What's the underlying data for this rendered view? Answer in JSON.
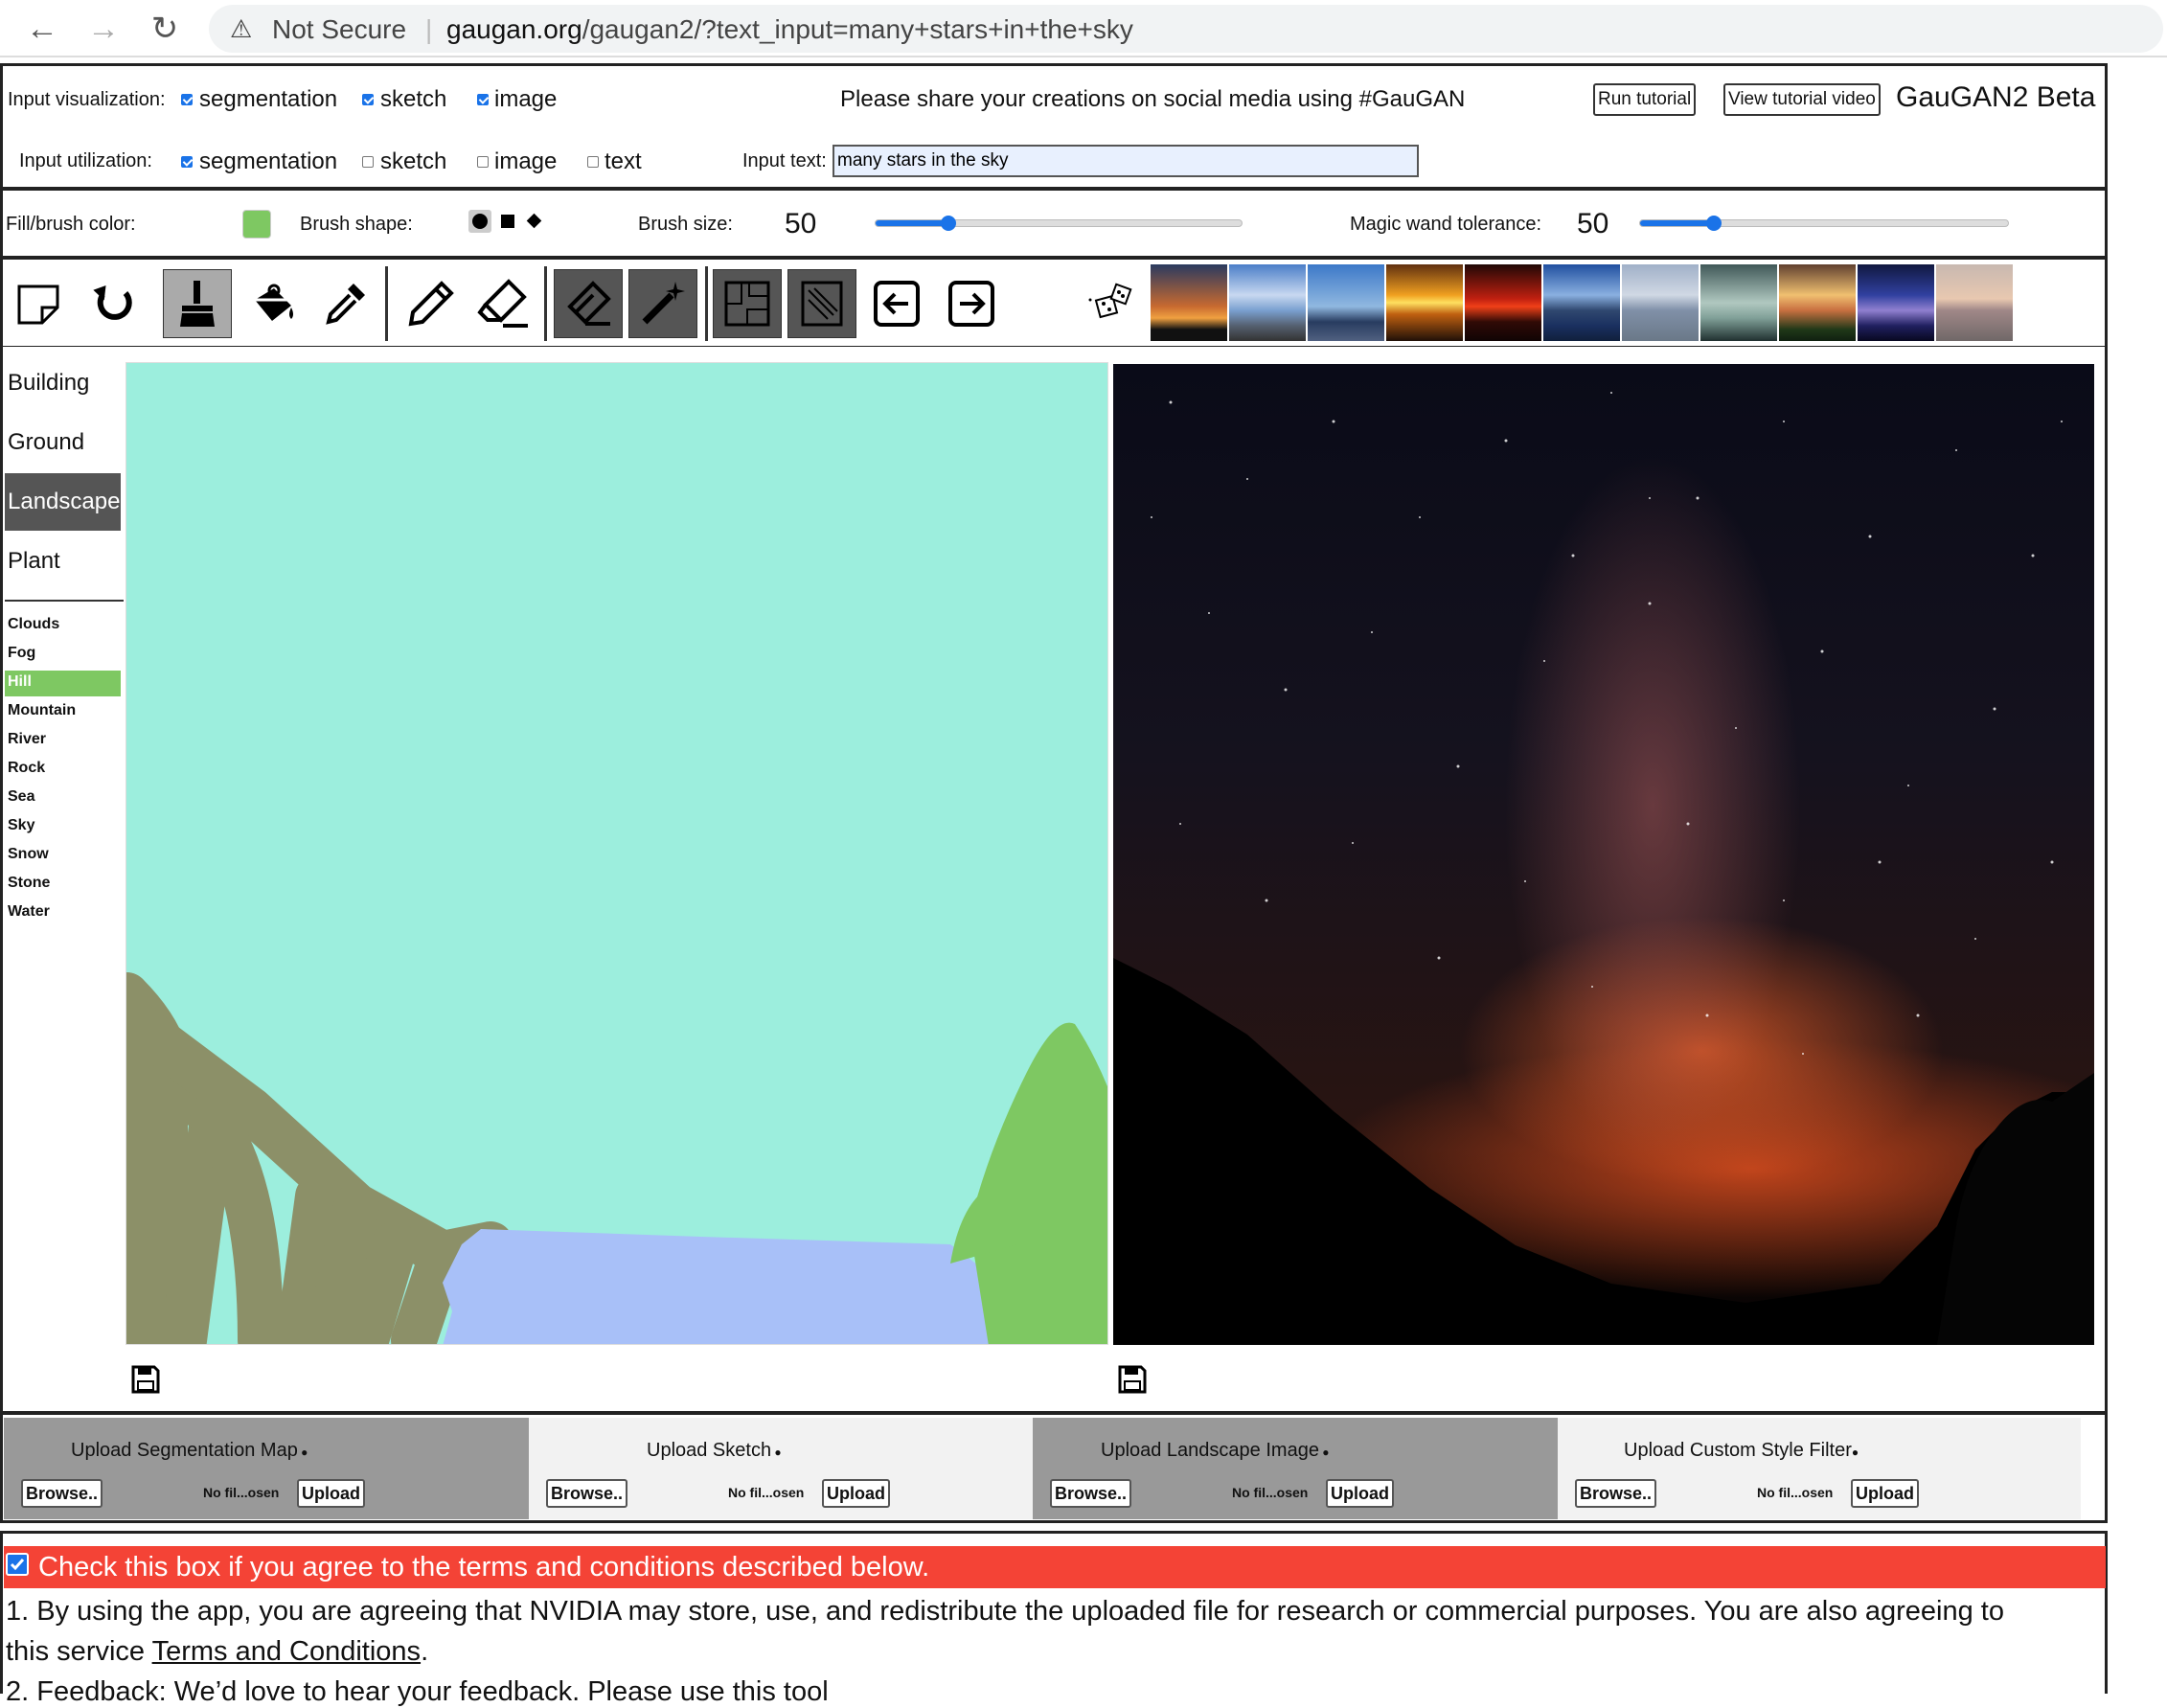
{
  "browser": {
    "security_label": "Not Secure",
    "url_host": "gaugan.org",
    "url_path": "/gaugan2/?text_input=many+stars+in+the+sky"
  },
  "header": {
    "input_visualization_label": "Input visualization:",
    "vis_segmentation": "segmentation",
    "vis_sketch": "sketch",
    "vis_image": "image",
    "share_text": "Please share your creations on social media using #GauGAN",
    "run_tutorial": "Run tutorial",
    "view_tutorial_video": "View tutorial video",
    "app_title": "GauGAN2 Beta",
    "input_utilization_label": "Input utilization:",
    "util_segmentation": "segmentation",
    "util_sketch": "sketch",
    "util_image": "image",
    "util_text": "text",
    "input_text_label": "Input text:",
    "input_text_value": "many stars in the sky"
  },
  "brush": {
    "fill_color_label": "Fill/brush color:",
    "fill_color": "#7ec862",
    "brush_shape_label": "Brush shape:",
    "brush_size_label": "Brush size:",
    "brush_size_value": "50",
    "brush_size_fraction": 0.2,
    "magic_wand_label": "Magic wand tolerance:",
    "magic_wand_value": "50",
    "magic_wand_fraction": 0.2
  },
  "tools": [
    "new-canvas-icon",
    "undo-icon",
    "brush-icon",
    "paint-bucket-icon",
    "eyedropper-icon",
    "pencil-icon",
    "sketch-eraser-icon",
    "eraser-icon",
    "magic-wand-icon",
    "segment-to-sketch-icon",
    "sketch-to-segment-icon",
    "arrow-left-icon",
    "arrow-right-icon",
    "dice-icon"
  ],
  "categories": {
    "main": [
      "Building",
      "Ground",
      "Landscape",
      "Plant"
    ],
    "selected_main": "Landscape",
    "sub": [
      "Clouds",
      "Fog",
      "Hill",
      "Mountain",
      "River",
      "Rock",
      "Sea",
      "Sky",
      "Snow",
      "Stone",
      "Water"
    ],
    "selected_sub": "Hill",
    "selected_sub_color": "#7ec862"
  },
  "colors": {
    "sky_label_color": "#9ceedd",
    "hill_color": "#8c9068",
    "water_color": "#a8c0f8",
    "tree_color": "#7ec862",
    "selected_category_bg": "#555555"
  },
  "uploads": [
    {
      "title": "Upload Segmentation Map",
      "browse": "Browse..",
      "nofile": "No fil...osen",
      "upload": "Upload"
    },
    {
      "title": "Upload Sketch",
      "browse": "Browse..",
      "nofile": "No fil...osen",
      "upload": "Upload"
    },
    {
      "title": "Upload Landscape Image",
      "browse": "Browse..",
      "nofile": "No fil...osen",
      "upload": "Upload"
    },
    {
      "title": "Upload Custom Style Filter",
      "browse": "Browse..",
      "nofile": "No fil...osen",
      "upload": "Upload"
    }
  ],
  "terms": {
    "checkbox_label": "Check this box if you agree to the terms and conditions described below.",
    "line1_prefix": "1. By using the app, you are agreeing that NVIDIA may store, use, and redistribute the uploaded file for research or commercial purposes. You are also agreeing to",
    "line1b_prefix": "this service ",
    "terms_link": "Terms and Conditions",
    "line1b_suffix": ".",
    "line2": "2. Feedback: We’d love to hear your feedback. Please use this tool"
  }
}
